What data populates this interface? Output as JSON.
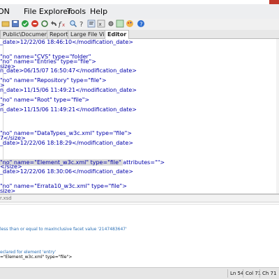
{
  "window": {
    "app_title_fragment": "SON"
  },
  "menu": {
    "items": [
      "File Explorer",
      "Tools",
      "Help"
    ]
  },
  "toolbar": {
    "icons": [
      "open-icon",
      "save-icon",
      "validate-check-icon",
      "stop-icon",
      "refresh-icon",
      "undo-icon",
      "redo-icon",
      "fx-icon",
      "find-icon",
      "format-icon",
      "help-icon",
      "xpath-icon",
      "info-icon"
    ]
  },
  "tabs": [
    {
      "label": "Public\\Documents\\xml",
      "active": false
    },
    {
      "label": "Reports",
      "active": false
    },
    {
      "label": "Large File Viewer",
      "active": false
    },
    {
      "label": "Editor",
      "active": true
    }
  ],
  "editor": {
    "lines": [
      {
        "text": "_date>12/22/06 18:46:10</modification_date>"
      },
      {
        "text": ""
      },
      {
        "text": ""
      },
      {
        "text": "\"no\" name=\"CVS\" type=\"folder\""
      },
      {
        "text": "\"no\" name=\"Entries\" type=\"file\">"
      },
      {
        "text": "size>"
      },
      {
        "text": "n_date>06/15/07 16:50:47</modification_date>"
      },
      {
        "text": ""
      },
      {
        "text": "\"no\" name=\"Repository\" type=\"file\">"
      },
      {
        "text": ">"
      },
      {
        "text": "n_date>11/15/06 11:49:21</modification_date>"
      },
      {
        "text": ""
      },
      {
        "text": "\"no\" name=\"Root\" type=\"file\">"
      },
      {
        "text": ">"
      },
      {
        "text": "n_date>11/15/06 11:49:21</modification_date>"
      },
      {
        "text": ""
      },
      {
        "text": ""
      },
      {
        "text": ""
      },
      {
        "text": ""
      },
      {
        "text": "\"no\" name=\"DataTypes_w3c.xml\" type=\"file\">"
      },
      {
        "text": "7</size>"
      },
      {
        "text": "_date>12/22/06 18:18:29</modification_date>"
      },
      {
        "text": ""
      },
      {
        "text": ""
      },
      {
        "text": ""
      },
      {
        "text": "\"no\" name=\"Element_w3c.xml\" type=\"file\" attributes=\"\">",
        "highlight": true
      },
      {
        "text": "</size>"
      },
      {
        "text": "_date>12/22/06 18:30:06</modification_date>"
      },
      {
        "text": ""
      },
      {
        "text": ""
      },
      {
        "text": "\"no\" name=\"Errata10_w3c.xml\" type=\"file\">"
      },
      {
        "text": "size>"
      }
    ]
  },
  "output": {
    "file_label": "r.xsd",
    "messages": [
      {
        "text": "less than or equal to maxInclusive facet value '2147483647'",
        "style": "blue"
      },
      {
        "text": "eclared for element 'entry'",
        "style": "blue"
      },
      {
        "text": "=\"Element_w3c.xml\" type=\"file\">",
        "style": "dark"
      }
    ]
  },
  "status": {
    "line": "Ln 54",
    "col": "Col 71",
    "ch": "Ch 71"
  }
}
